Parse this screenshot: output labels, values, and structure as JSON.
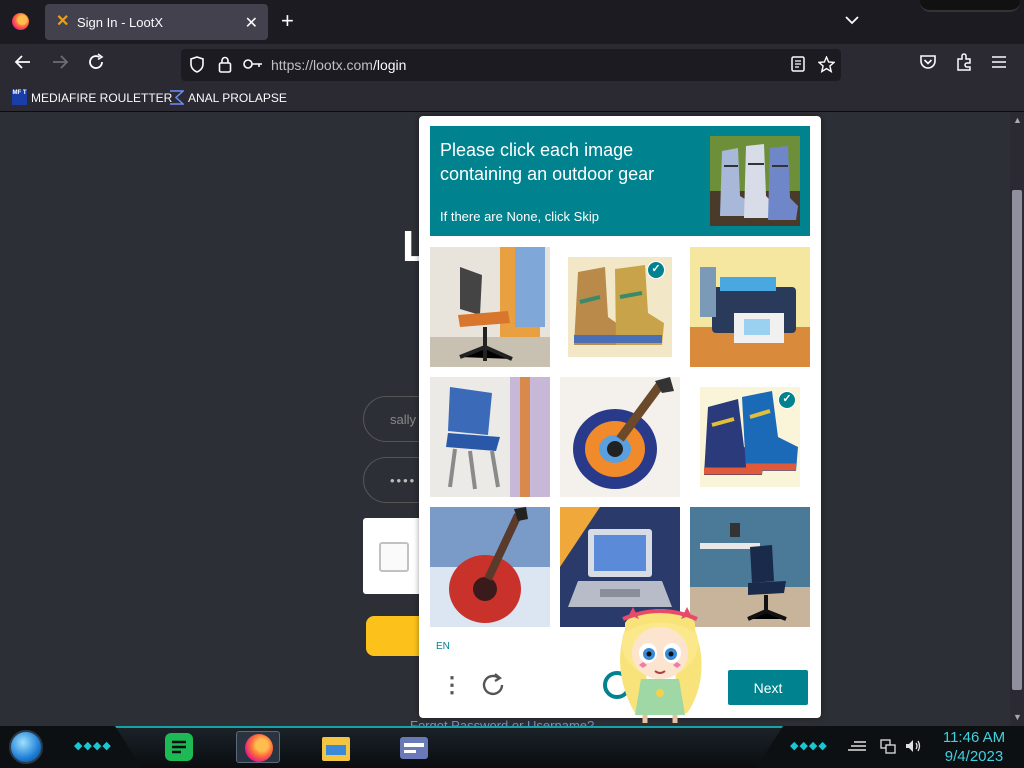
{
  "browser": {
    "tab": {
      "title": "Sign In - LootX",
      "close": "✕"
    },
    "new_tab": "+",
    "tab_list": "⌄",
    "url_host": "https://lootx.com",
    "url_path": "/login",
    "bookmarks": [
      {
        "label": "MEDIAFIRE ROULETTER",
        "icon_text": "MF T"
      },
      {
        "label": "ANAL PROLAPSE"
      }
    ],
    "icons": [
      "back-icon",
      "forward-icon",
      "reload-icon",
      "shield-icon",
      "lock-icon",
      "key-icon",
      "reader-mode-icon",
      "star-icon",
      "pocket-icon",
      "extensions-icon",
      "menu-icon"
    ]
  },
  "page": {
    "heading_partial": "L",
    "username_value": "sally",
    "password_value": "••••",
    "forgot_text": "Forgot Password or Username?"
  },
  "challenge": {
    "prompt": "Please click each image containing an outdoor gear",
    "sub": "If there are None, click Skip",
    "lang": "EN",
    "next_label": "Next",
    "tiles": [
      {
        "subject": "office chair",
        "selected": false
      },
      {
        "subject": "boots",
        "selected": true
      },
      {
        "subject": "printer",
        "selected": false
      },
      {
        "subject": "chair",
        "selected": false
      },
      {
        "subject": "guitar",
        "selected": false
      },
      {
        "subject": "hiking boots",
        "selected": true
      },
      {
        "subject": "guitar",
        "selected": false
      },
      {
        "subject": "laptop",
        "selected": false
      },
      {
        "subject": "office chair",
        "selected": false
      }
    ],
    "accent_color": "#00838f"
  },
  "taskbar": {
    "time": "11:46 AM",
    "date": "9/4/2023",
    "apps": [
      "notes-app",
      "firefox",
      "file-explorer",
      "media-app"
    ]
  }
}
